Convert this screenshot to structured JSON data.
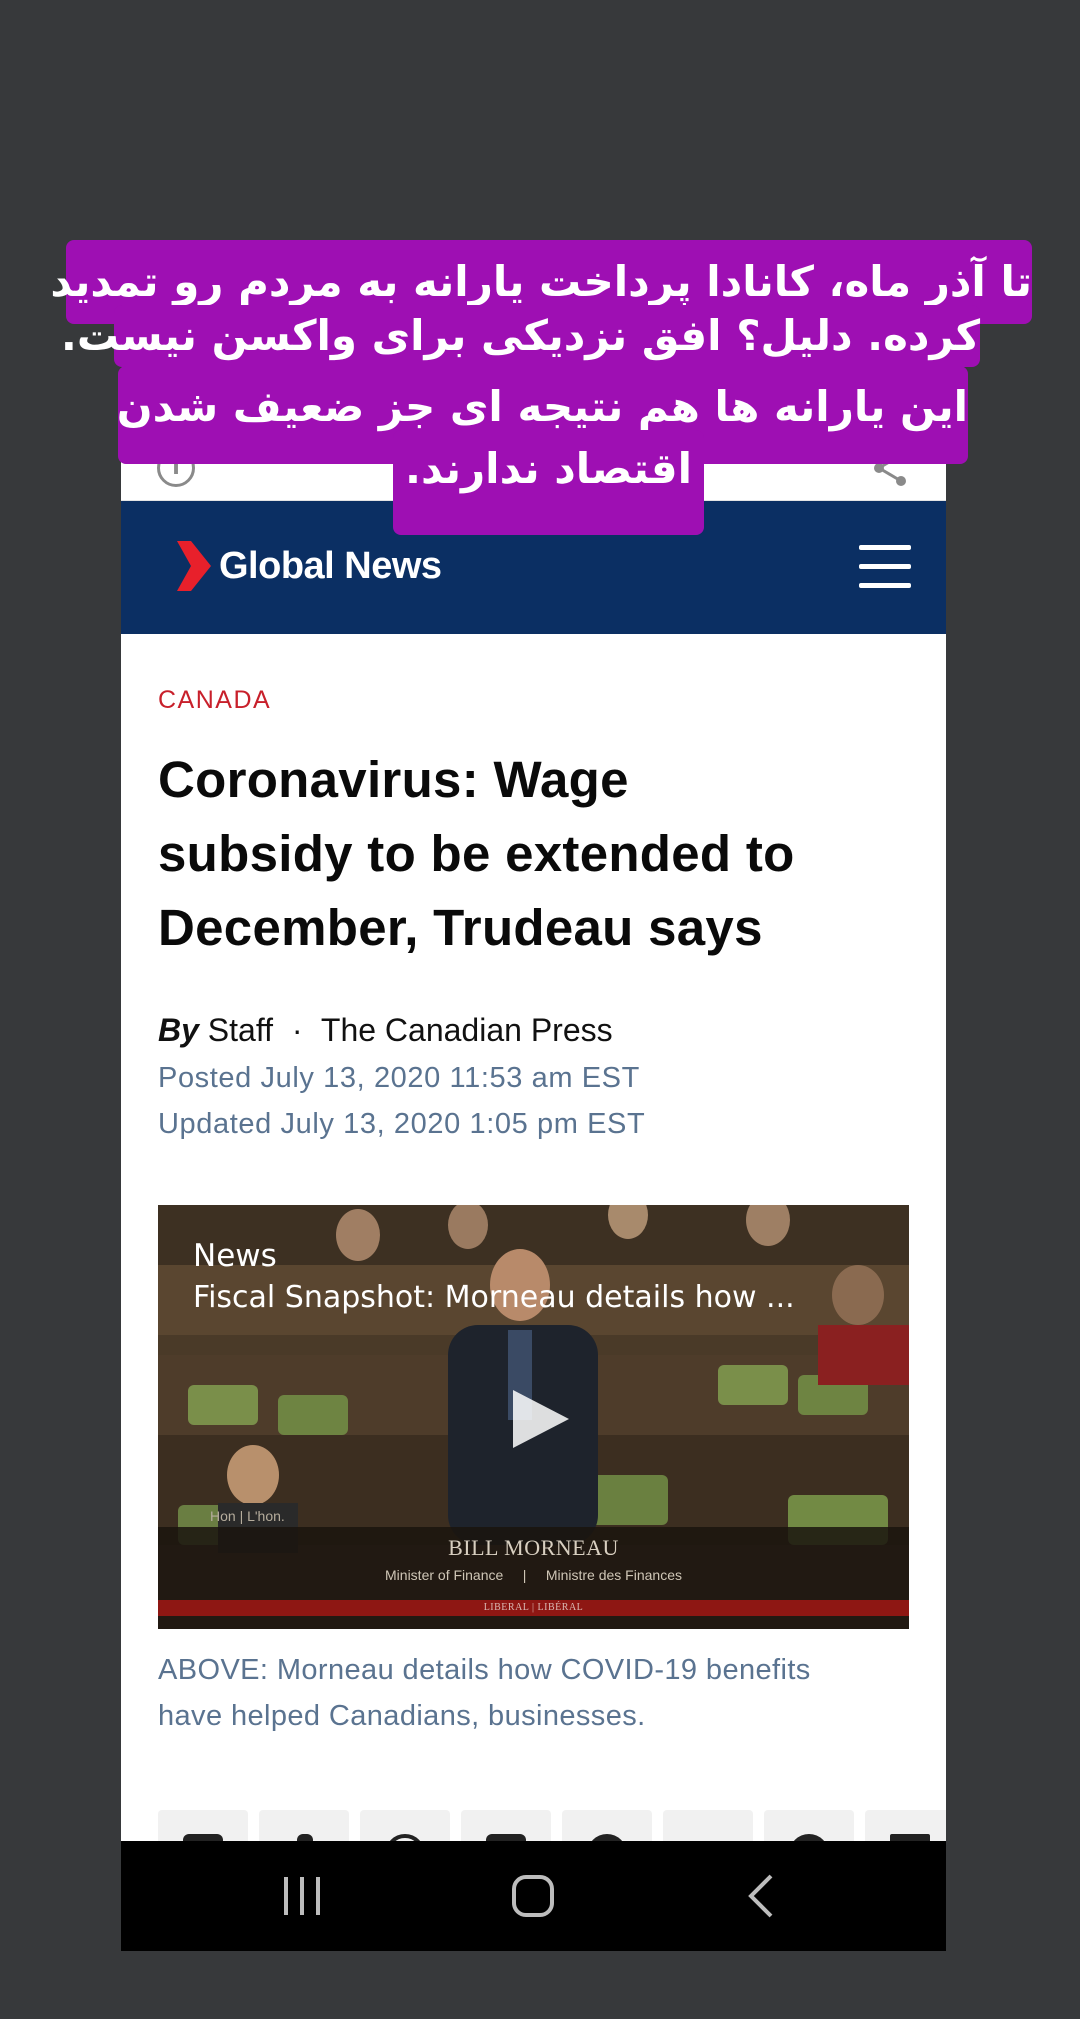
{
  "browser": {
    "info_icon": "info-circle-icon",
    "share_icon": "share-icon"
  },
  "site": {
    "logo_text": "Global News",
    "menu_icon": "hamburger-menu-icon",
    "brand_color": "#0b2f63",
    "accent_color": "#e8202b"
  },
  "article": {
    "category": "CANADA",
    "headline_lines": [
      "Coronavirus: Wage",
      "subsidy to be extended to",
      "December, Trudeau says"
    ],
    "byline_prefix": "By",
    "author": "Staff",
    "separator": "·",
    "source": "The Canadian Press",
    "posted": "Posted July 13, 2020 11:53 am EST",
    "updated": "Updated July 13, 2020 1:05 pm EST",
    "caption_lines": [
      "ABOVE: Morneau details how COVID-19 benefits",
      "have helped Canadians, businesses."
    ]
  },
  "video": {
    "category": "News",
    "title": "Fiscal Snapshot: Morneau details how ...",
    "play_icon": "play-icon",
    "chyron_hon": "Hon  |  L'hon.",
    "chyron_name": "BILL MORNEAU",
    "chyron_role": "Minister of Finance     |     Ministre des Finances",
    "chyron_party": "LIBERAL | LIBÉRAL"
  },
  "share_buttons": [
    "email-share-icon",
    "facebook-share-icon",
    "whatsapp-share-icon",
    "sms-share-icon",
    "twitter-share-icon",
    "reddit-share-icon",
    "pinterest-share-icon",
    "linkedin-share-icon"
  ],
  "nav": {
    "recents_icon": "recent-apps-icon",
    "home_icon": "home-icon",
    "back_icon": "back-icon"
  },
  "overlay": {
    "lines": [
      "تا آذر ماه، کانادا پرداخت یارانه به مردم رو تمدید",
      "کرده. دلیل؟ افق نزدیکی برای واکسن نیست.",
      "این یارانه ها هم نتیجه ای جز ضعیف شدن",
      "اقتصاد ندارند."
    ],
    "background_color": "#9e0fb3"
  }
}
